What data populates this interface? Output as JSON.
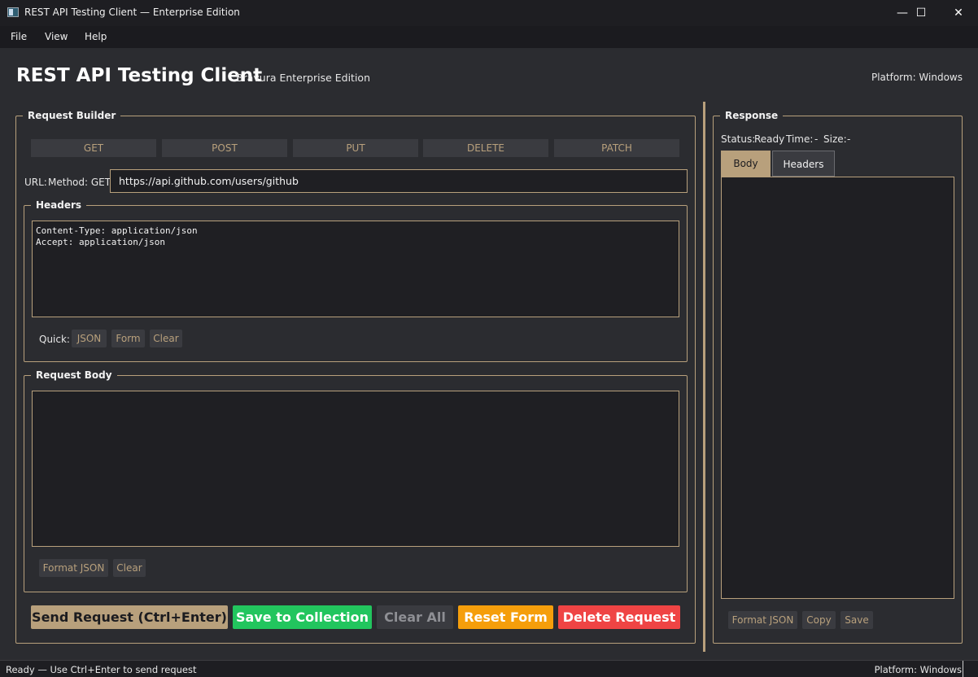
{
  "window": {
    "title": "REST API Testing Client — Enterprise Edition",
    "minimize": "—",
    "maximize": "☐",
    "close": "✕"
  },
  "menu": {
    "file": "File",
    "view": "View",
    "help": "Help"
  },
  "header": {
    "title": "REST API Testing Client",
    "subtitle": "Bravura Enterprise Edition",
    "platform": "Platform: Windows"
  },
  "request_builder": {
    "legend": "Request Builder",
    "methods": [
      "GET",
      "POST",
      "PUT",
      "DELETE",
      "PATCH"
    ],
    "url_label": "URL:",
    "method_label": "Method: GET",
    "url_value": "https://api.github.com/users/github",
    "headers": {
      "legend": "Headers",
      "lines": [
        "Content-Type: application/json",
        "Accept: application/json"
      ],
      "quick_label": "Quick:",
      "quick_buttons": [
        "JSON",
        "Form",
        "Clear"
      ]
    },
    "body": {
      "legend": "Request Body",
      "value": "",
      "buttons": [
        "Format JSON",
        "Clear"
      ]
    },
    "actions": {
      "send": "Send Request (Ctrl+Enter)",
      "save": "Save to Collection",
      "clear_all": "Clear All",
      "reset": "Reset Form",
      "delete": "Delete Request"
    }
  },
  "response": {
    "legend": "Response",
    "status_label": "Status:",
    "status_value": "Ready",
    "time_label": "Time:",
    "time_value": "-",
    "size_label": "Size:",
    "size_value": "-",
    "tabs": [
      "Body",
      "Headers"
    ],
    "active_tab": "Body",
    "buttons": [
      "Format JSON",
      "Copy",
      "Save"
    ]
  },
  "statusbar": {
    "left": "Ready — Use Ctrl+Enter to send request",
    "right": "Platform: Windows"
  },
  "colors": {
    "accent": "#b8a07c",
    "save": "#22c55e",
    "reset": "#f59e0b",
    "delete": "#ef4444",
    "background": "#2b2c30",
    "input_bg": "#1f1f23"
  }
}
